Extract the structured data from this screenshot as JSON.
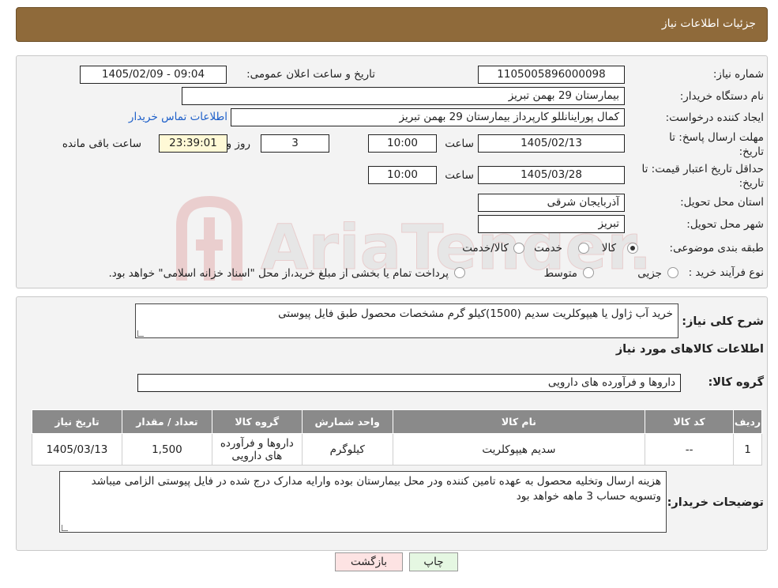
{
  "header": {
    "title": "جزئیات اطلاعات نیاز"
  },
  "watermark": {
    "text": "AriaTender.neT"
  },
  "form": {
    "need_number_label": "شماره نیاز:",
    "need_number": "1105005896000098",
    "announce_label": "تاریخ و ساعت اعلان عمومی:",
    "announce_value": "1405/02/09 - 09:04",
    "buyer_org_label": "نام دستگاه خریدار:",
    "buyer_org": "بیمارستان 29 بهمن تبریز",
    "requester_label": "ایجاد کننده درخواست:",
    "requester": "کمال پوراینانللو کارپرداز بیمارستان 29 بهمن تبریز",
    "contact_link": "اطلاعات تماس خریدار",
    "deadline_label_1": "مهلت ارسال پاسخ: تا",
    "deadline_label_2": "تاریخ:",
    "deadline_date": "1405/02/13",
    "time_label": "ساعت",
    "deadline_time": "10:00",
    "days_value": "3",
    "days_label": "روز و",
    "remaining_time": "23:39:01",
    "remaining_label": "ساعت باقی مانده",
    "validity_label_1": "حداقل تاریخ اعتبار قیمت: تا",
    "validity_label_2": "تاریخ:",
    "validity_date": "1405/03/28",
    "validity_time": "10:00",
    "province_label": "استان محل تحویل:",
    "province": "آذربایجان شرقی",
    "city_label": "شهر محل تحویل:",
    "city": "تبریز",
    "category_label": "طبقه بندی موضوعی:",
    "category_options": [
      "کالا",
      "خدمت",
      "کالا/خدمت"
    ],
    "category_selected": "کالا",
    "process_label": "نوع فرآیند خرید :",
    "process_options": [
      "جزیی",
      "متوسط"
    ],
    "process_note": "پرداخت تمام یا بخشی از مبلغ خرید،از محل \"اسناد خزانه اسلامی\" خواهد بود."
  },
  "details": {
    "summary_label": "شرح کلی نیاز:",
    "summary": "خرید آب ژاول یا هیپوکلریت سدیم (1500)کیلو گرم مشخصات محصول طبق فایل پیوستی",
    "goods_info_title": "اطلاعات کالاهای مورد نیاز",
    "goods_group_label": "گروه کالا:",
    "goods_group": "داروها و فرآورده های دارویی",
    "table": {
      "headers": [
        "ردیف",
        "کد کالا",
        "نام کالا",
        "واحد شمارش",
        "گروه کالا",
        "تعداد / مقدار",
        "تاریخ نیاز"
      ],
      "rows": [
        [
          "1",
          "--",
          "سدیم هیپوکلریت",
          "کیلوگرم",
          "داروها و فرآورده های دارویی",
          "1,500",
          "1405/03/13"
        ]
      ]
    },
    "buyer_notes_label": "توضیحات خریدار:",
    "buyer_notes": "هزینه ارسال وتخلیه محصول به عهده تامین کننده ودر محل بیمارستان بوده وارایه مدارک درج شده در فایل پیوستی الزامی میباشد وتسویه حساب 3 ماهه خواهد بود"
  },
  "buttons": {
    "print": "چاپ",
    "back": "بازگشت"
  }
}
